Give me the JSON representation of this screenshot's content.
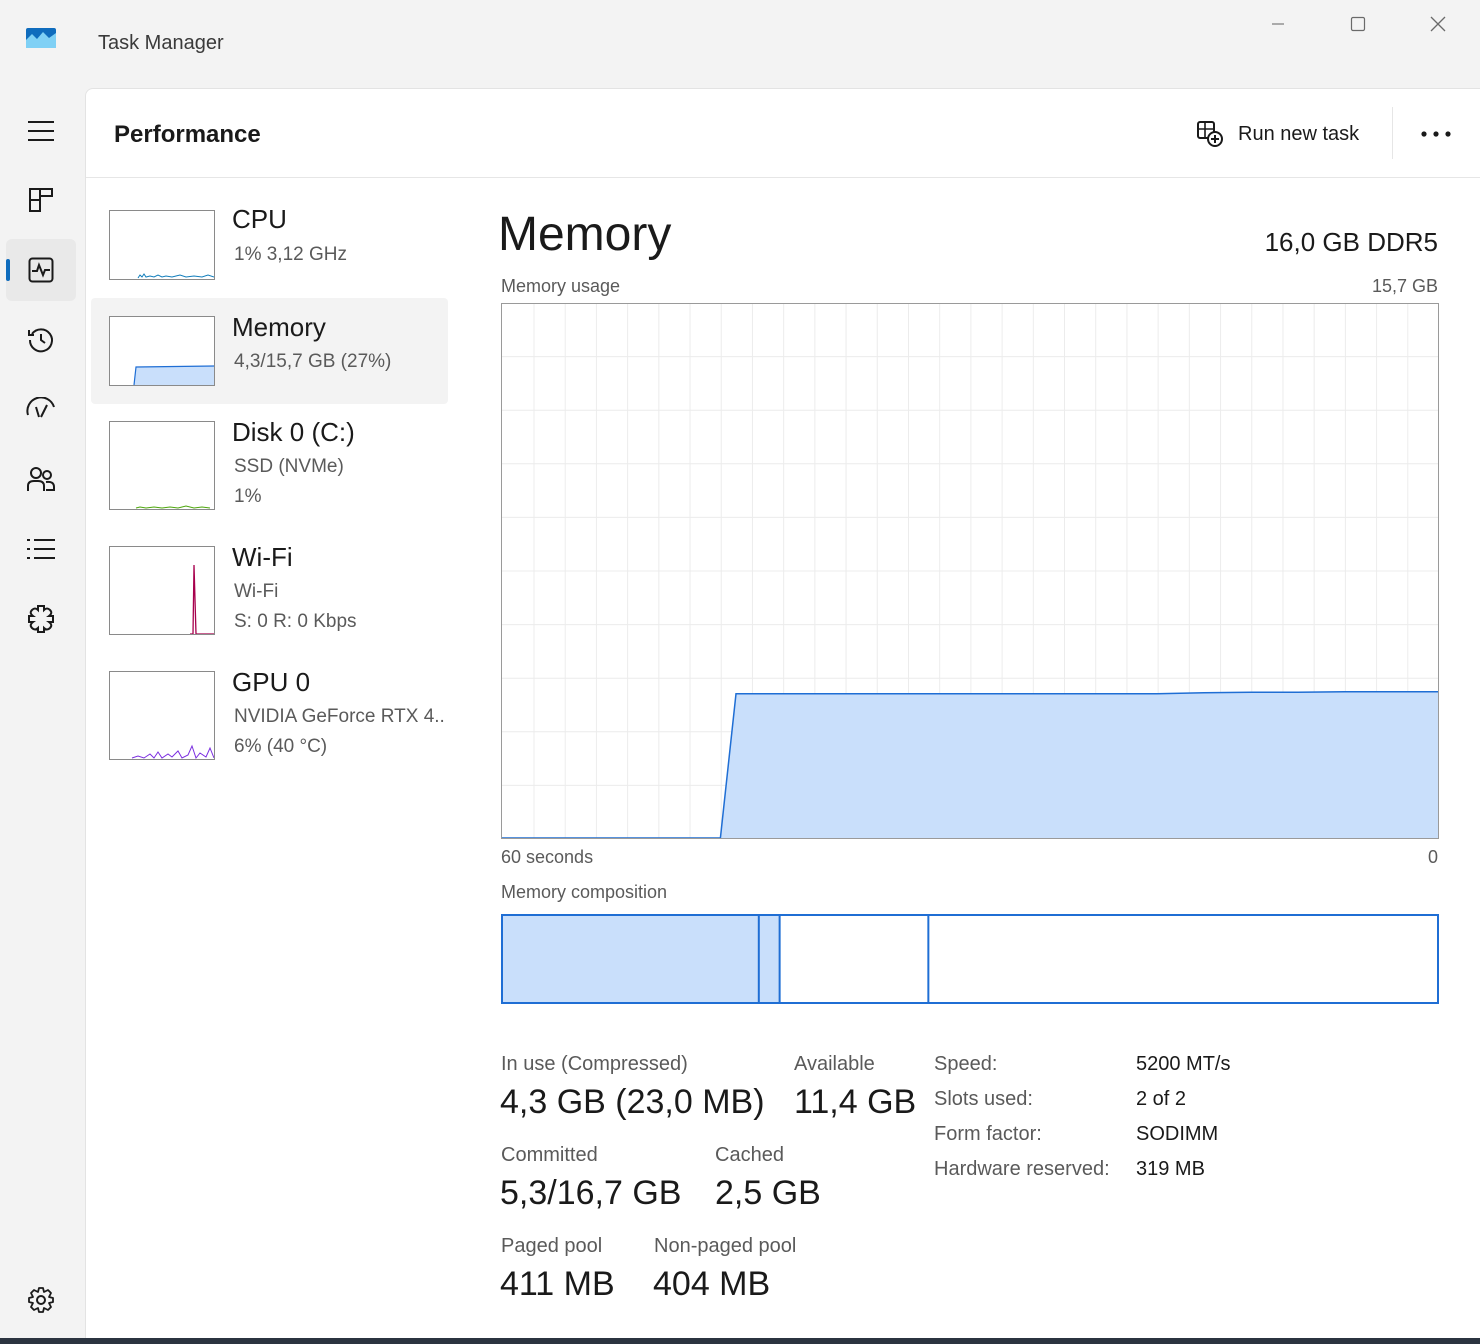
{
  "window": {
    "title": "Task Manager"
  },
  "header": {
    "title": "Performance",
    "run_new_task": "Run new task"
  },
  "nav": {
    "items": [
      {
        "id": "hamburger",
        "icon": "hamburger-icon"
      },
      {
        "id": "processes",
        "icon": "processes-icon"
      },
      {
        "id": "performance",
        "icon": "performance-icon",
        "active": true
      },
      {
        "id": "app-history",
        "icon": "history-icon"
      },
      {
        "id": "startup",
        "icon": "startup-icon"
      },
      {
        "id": "users",
        "icon": "users-icon"
      },
      {
        "id": "details",
        "icon": "details-icon"
      },
      {
        "id": "services",
        "icon": "services-icon"
      },
      {
        "id": "settings",
        "icon": "gear-icon"
      }
    ]
  },
  "resources": [
    {
      "name": "CPU",
      "sub1": "1%  3,12 GHz",
      "sub2": "",
      "color": "#117dbb"
    },
    {
      "name": "Memory",
      "sub1": "4,3/15,7 GB (27%)",
      "sub2": "",
      "color": "#1f6ed4",
      "active": true
    },
    {
      "name": "Disk 0 (C:)",
      "sub1": "SSD (NVMe)",
      "sub2": "1%",
      "color": "#4da60c"
    },
    {
      "name": "Wi-Fi",
      "sub1": "Wi-Fi",
      "sub2": "S: 0  R: 0 Kbps",
      "color": "#a7004d"
    },
    {
      "name": "GPU 0",
      "sub1": "NVIDIA GeForce RTX 4..",
      "sub2": "6%  (40 °C)",
      "color": "#7b2ee0"
    }
  ],
  "detail": {
    "title": "Memory",
    "type": "16,0 GB DDR5",
    "usage_label": "Memory usage",
    "usage_max": "15,7 GB",
    "time_left": "60 seconds",
    "time_right": "0",
    "composition_label": "Memory composition",
    "stats": {
      "in_use_label": "In use (Compressed)",
      "in_use_value": "4,3 GB (23,0 MB)",
      "available_label": "Available",
      "available_value": "11,4 GB",
      "committed_label": "Committed",
      "committed_value": "5,3/16,7 GB",
      "cached_label": "Cached",
      "cached_value": "2,5 GB",
      "paged_label": "Paged pool",
      "paged_value": "411 MB",
      "nonpaged_label": "Non-paged pool",
      "nonpaged_value": "404 MB"
    },
    "specs": [
      {
        "label": "Speed:",
        "value": "5200 MT/s"
      },
      {
        "label": "Slots used:",
        "value": "2 of 2"
      },
      {
        "label": "Form factor:",
        "value": "SODIMM"
      },
      {
        "label": "Hardware reserved:",
        "value": "319 MB"
      }
    ]
  },
  "chart_data": {
    "type": "area",
    "x": [
      60,
      57,
      54,
      51,
      48,
      46,
      45,
      42,
      39,
      36,
      33,
      30,
      27,
      24,
      21,
      18,
      15,
      12,
      9,
      6,
      3,
      0
    ],
    "values": [
      0,
      0,
      0,
      0,
      0,
      0,
      27,
      27,
      27,
      27,
      27,
      27,
      27,
      27,
      27,
      27,
      27.2,
      27.3,
      27.3,
      27.4,
      27.4,
      27.4
    ],
    "ylim": [
      0,
      100
    ],
    "xlim": [
      60,
      0
    ],
    "grid": true,
    "color": "#1f6ed4",
    "fill": "#c9dffb",
    "composition": {
      "in_use": 4.3,
      "modified": 0.35,
      "standby": 2.5,
      "free": 8.55,
      "total": 15.7
    }
  }
}
